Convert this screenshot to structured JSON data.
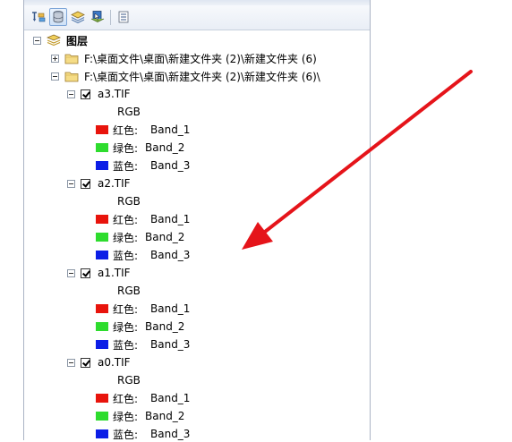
{
  "toc": {
    "root": {
      "label": "图层"
    },
    "folders": [
      {
        "path": "F:\\桌面文件\\桌面\\新建文件夹 (2)\\新建文件夹 (6)",
        "expanded": false
      },
      {
        "path": "F:\\桌面文件\\桌面\\新建文件夹 (2)\\新建文件夹 (6)\\",
        "expanded": true
      }
    ],
    "layers": [
      {
        "name": "a3.TIF",
        "checked": true,
        "renderer": "RGB",
        "bands": [
          {
            "label": "红色:",
            "band": "Band_1",
            "color": "#e8140c"
          },
          {
            "label": "绿色:",
            "band": "Band_2",
            "color": "#2edc2e"
          },
          {
            "label": "蓝色:",
            "band": "Band_3",
            "color": "#0c1ee6"
          }
        ]
      },
      {
        "name": "a2.TIF",
        "checked": true,
        "renderer": "RGB",
        "bands": [
          {
            "label": "红色:",
            "band": "Band_1",
            "color": "#e8140c"
          },
          {
            "label": "绿色:",
            "band": "Band_2",
            "color": "#2edc2e"
          },
          {
            "label": "蓝色:",
            "band": "Band_3",
            "color": "#0c1ee6"
          }
        ]
      },
      {
        "name": "a1.TIF",
        "checked": true,
        "renderer": "RGB",
        "bands": [
          {
            "label": "红色:",
            "band": "Band_1",
            "color": "#e8140c"
          },
          {
            "label": "绿色:",
            "band": "Band_2",
            "color": "#2edc2e"
          },
          {
            "label": "蓝色:",
            "band": "Band_3",
            "color": "#0c1ee6"
          }
        ]
      },
      {
        "name": "a0.TIF",
        "checked": true,
        "renderer": "RGB",
        "bands": [
          {
            "label": "红色:",
            "band": "Band_1",
            "color": "#e8140c"
          },
          {
            "label": "绿色:",
            "band": "Band_2",
            "color": "#2edc2e"
          },
          {
            "label": "蓝色:",
            "band": "Band_3",
            "color": "#0c1ee6"
          }
        ]
      }
    ]
  },
  "toolbar": {
    "buttons": [
      {
        "icon": "list-by-drawing-order-icon",
        "active": false
      },
      {
        "icon": "list-by-source-icon",
        "active": true
      },
      {
        "icon": "list-by-visibility-icon",
        "active": false
      },
      {
        "icon": "list-by-selection-icon",
        "active": false
      },
      {
        "icon": "options-icon",
        "active": false
      }
    ]
  },
  "annotation": {
    "arrow_color": "#e5141a"
  }
}
